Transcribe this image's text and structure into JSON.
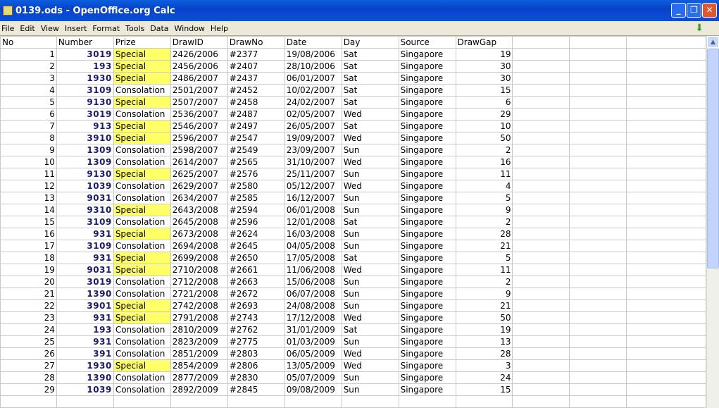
{
  "window": {
    "title": "0139.ods - OpenOffice.org Calc"
  },
  "menu": [
    "File",
    "Edit",
    "View",
    "Insert",
    "Format",
    "Tools",
    "Data",
    "Window",
    "Help"
  ],
  "columns": [
    "No",
    "Number",
    "Prize",
    "DrawID",
    "DrawNo",
    "Date",
    "Day",
    "Source",
    "DrawGap",
    "",
    "",
    ""
  ],
  "colors": {
    "special_highlight": "#ffff66",
    "number_text": "#1a1a6e"
  },
  "rows": [
    [
      1,
      "3019",
      "Special",
      "2426/2006",
      "#2377",
      "19/08/2006",
      "Sat",
      "Singapore",
      19
    ],
    [
      2,
      "193",
      "Special",
      "2456/2006",
      "#2407",
      "28/10/2006",
      "Sat",
      "Singapore",
      30
    ],
    [
      3,
      "1930",
      "Special",
      "2486/2007",
      "#2437",
      "06/01/2007",
      "Sat",
      "Singapore",
      30
    ],
    [
      4,
      "3109",
      "Consolation",
      "2501/2007",
      "#2452",
      "10/02/2007",
      "Sat",
      "Singapore",
      15
    ],
    [
      5,
      "9130",
      "Special",
      "2507/2007",
      "#2458",
      "24/02/2007",
      "Sat",
      "Singapore",
      6
    ],
    [
      6,
      "3019",
      "Consolation",
      "2536/2007",
      "#2487",
      "02/05/2007",
      "Wed",
      "Singapore",
      29
    ],
    [
      7,
      "913",
      "Special",
      "2546/2007",
      "#2497",
      "26/05/2007",
      "Sat",
      "Singapore",
      10
    ],
    [
      8,
      "3910",
      "Special",
      "2596/2007",
      "#2547",
      "19/09/2007",
      "Wed",
      "Singapore",
      50
    ],
    [
      9,
      "1309",
      "Consolation",
      "2598/2007",
      "#2549",
      "23/09/2007",
      "Sun",
      "Singapore",
      2
    ],
    [
      10,
      "1309",
      "Consolation",
      "2614/2007",
      "#2565",
      "31/10/2007",
      "Wed",
      "Singapore",
      16
    ],
    [
      11,
      "9130",
      "Special",
      "2625/2007",
      "#2576",
      "25/11/2007",
      "Sun",
      "Singapore",
      11
    ],
    [
      12,
      "1039",
      "Consolation",
      "2629/2007",
      "#2580",
      "05/12/2007",
      "Wed",
      "Singapore",
      4
    ],
    [
      13,
      "9031",
      "Consolation",
      "2634/2007",
      "#2585",
      "16/12/2007",
      "Sun",
      "Singapore",
      5
    ],
    [
      14,
      "9310",
      "Special",
      "2643/2008",
      "#2594",
      "06/01/2008",
      "Sun",
      "Singapore",
      9
    ],
    [
      15,
      "3109",
      "Consolation",
      "2645/2008",
      "#2596",
      "12/01/2008",
      "Sat",
      "Singapore",
      2
    ],
    [
      16,
      "931",
      "Special",
      "2673/2008",
      "#2624",
      "16/03/2008",
      "Sun",
      "Singapore",
      28
    ],
    [
      17,
      "3109",
      "Consolation",
      "2694/2008",
      "#2645",
      "04/05/2008",
      "Sun",
      "Singapore",
      21
    ],
    [
      18,
      "931",
      "Special",
      "2699/2008",
      "#2650",
      "17/05/2008",
      "Sat",
      "Singapore",
      5
    ],
    [
      19,
      "9031",
      "Special",
      "2710/2008",
      "#2661",
      "11/06/2008",
      "Wed",
      "Singapore",
      11
    ],
    [
      20,
      "3019",
      "Consolation",
      "2712/2008",
      "#2663",
      "15/06/2008",
      "Sun",
      "Singapore",
      2
    ],
    [
      21,
      "1390",
      "Consolation",
      "2721/2008",
      "#2672",
      "06/07/2008",
      "Sun",
      "Singapore",
      9
    ],
    [
      22,
      "3901",
      "Special",
      "2742/2008",
      "#2693",
      "24/08/2008",
      "Sun",
      "Singapore",
      21
    ],
    [
      23,
      "931",
      "Special",
      "2791/2008",
      "#2743",
      "17/12/2008",
      "Wed",
      "Singapore",
      50
    ],
    [
      24,
      "193",
      "Consolation",
      "2810/2009",
      "#2762",
      "31/01/2009",
      "Sat",
      "Singapore",
      19
    ],
    [
      25,
      "931",
      "Consolation",
      "2823/2009",
      "#2775",
      "01/03/2009",
      "Sun",
      "Singapore",
      13
    ],
    [
      26,
      "391",
      "Consolation",
      "2851/2009",
      "#2803",
      "06/05/2009",
      "Wed",
      "Singapore",
      28
    ],
    [
      27,
      "1930",
      "Special",
      "2854/2009",
      "#2806",
      "13/05/2009",
      "Wed",
      "Singapore",
      3
    ],
    [
      28,
      "1390",
      "Consolation",
      "2877/2009",
      "#2830",
      "05/07/2009",
      "Sun",
      "Singapore",
      24
    ],
    [
      29,
      "1039",
      "Consolation",
      "2892/2009",
      "#2845",
      "09/08/2009",
      "Sun",
      "Singapore",
      15
    ]
  ]
}
